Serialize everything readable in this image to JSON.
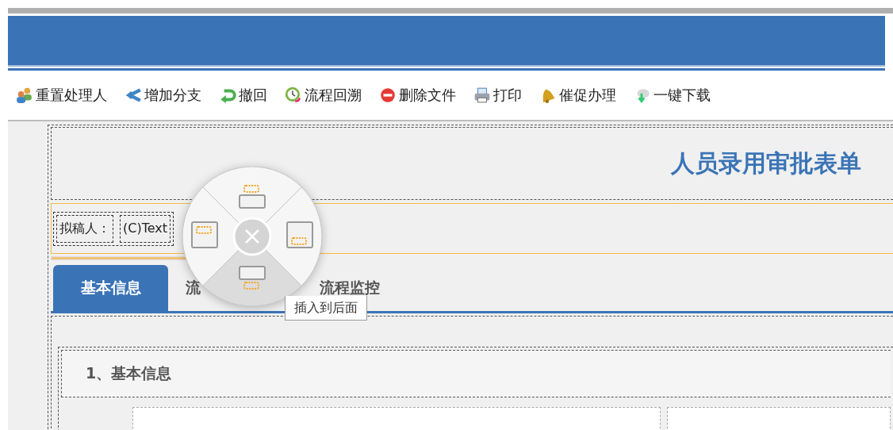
{
  "toolbar": [
    {
      "label": "重置处理人",
      "kind": "users"
    },
    {
      "label": "增加分支",
      "kind": "branch"
    },
    {
      "label": "撤回",
      "kind": "undo"
    },
    {
      "label": "流程回溯",
      "kind": "history"
    },
    {
      "label": "删除文件",
      "kind": "delete"
    },
    {
      "label": "打印",
      "kind": "print"
    },
    {
      "label": "催促办理",
      "kind": "bell"
    },
    {
      "label": "一键下载",
      "kind": "download"
    }
  ],
  "form": {
    "title": "人员录用审批表单",
    "drafter_label": "拟稿人：",
    "drafter_value": "(C)Text",
    "tabs": [
      {
        "label": "基本信息",
        "selected": true
      },
      {
        "label": "流",
        "selected": false
      },
      {
        "label": "流程监控",
        "selected": false
      }
    ],
    "section_title": "1、基本信息"
  },
  "radial_menu": {
    "items": [
      {
        "kind": "top",
        "selected": false
      },
      {
        "kind": "left",
        "selected": false
      },
      {
        "kind": "right",
        "selected": false
      },
      {
        "kind": "bottom",
        "selected": true
      }
    ],
    "tooltip": "插入到后面"
  }
}
